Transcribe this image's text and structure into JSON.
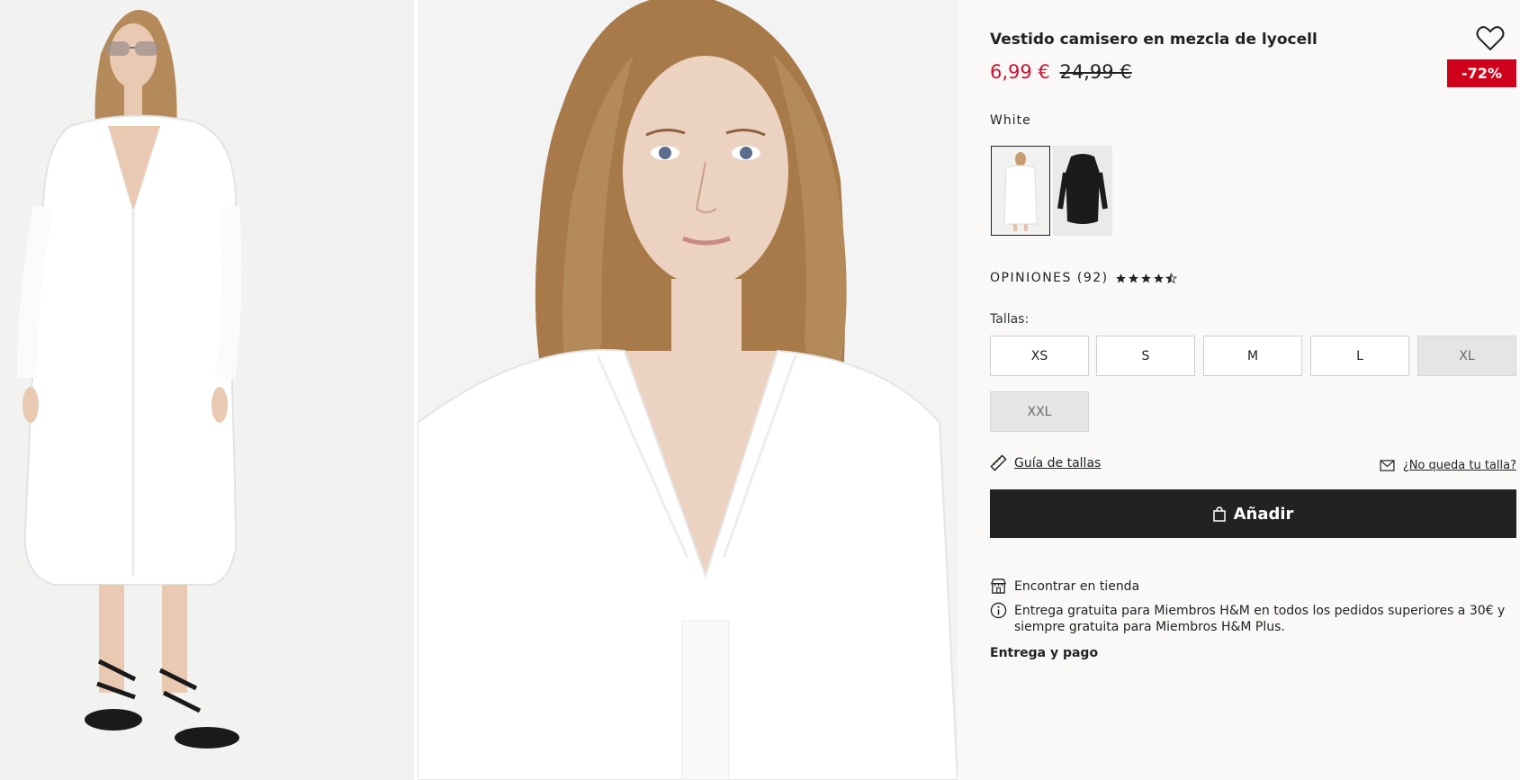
{
  "gallery": {
    "images": [
      {
        "alt": "model-full-length"
      },
      {
        "alt": "model-close-up"
      }
    ]
  },
  "product": {
    "title": "Vestido camisero en mezcla de lyocell",
    "price_current": "6,99 €",
    "price_original": "24,99 €",
    "discount": "-72%",
    "color_name": "White",
    "swatches": [
      "white",
      "black"
    ]
  },
  "reviews": {
    "label": "OPINIONES (92)",
    "rating": 4.5,
    "max": 5
  },
  "sizes": {
    "label": "Tallas:",
    "options": [
      {
        "label": "XS",
        "available": true
      },
      {
        "label": "S",
        "available": true
      },
      {
        "label": "M",
        "available": true
      },
      {
        "label": "L",
        "available": true
      },
      {
        "label": "XL",
        "available": false
      },
      {
        "label": "XXL",
        "available": false
      }
    ]
  },
  "links": {
    "size_guide": "Guía de tallas",
    "not_your_size": "¿No queda tu talla?"
  },
  "cart": {
    "add_label": "Añadir"
  },
  "services": {
    "find_in_store": "Encontrar en tienda",
    "free_delivery": "Entrega gratuita para Miembros H&M en todos los pedidos superiores a 30€ y siempre gratuita para Miembros H&M Plus.",
    "delivery_payment": "Entrega y pago"
  },
  "colors": {
    "sale_red": "#c8102e",
    "badge_red": "#d0021b",
    "button_dark": "#222222",
    "unavailable_bg": "#e5e5e5"
  },
  "icons": [
    "heart-icon",
    "star-icon",
    "ruler-icon",
    "envelope-icon",
    "shopping-bag-icon",
    "store-icon",
    "info-icon"
  ]
}
